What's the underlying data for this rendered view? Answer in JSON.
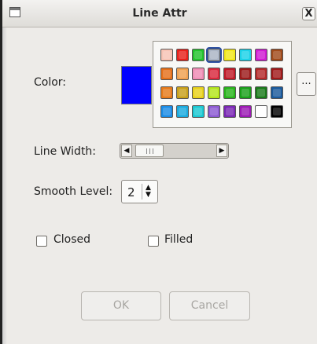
{
  "window": {
    "title": "Line Attr",
    "close_label": "X"
  },
  "color": {
    "label": "Color:",
    "current": "#0000ff",
    "more_button_label": "...",
    "palette": [
      [
        "#f7c3b4",
        "#e8201a",
        "#23c42c",
        "#aab4c4",
        "#f2e81a",
        "#1ad2e8",
        "#d01ad2",
        "#a04a1a"
      ],
      [
        "#e6701a",
        "#f0a050",
        "#f08cb4",
        "#d8283c",
        "#c01a28",
        "#9c1a1a",
        "#b42a2a",
        "#a01a1a"
      ],
      [
        "#e67a1a",
        "#c8a01a",
        "#e8d21a",
        "#b4e61a",
        "#28b41a",
        "#1aa01a",
        "#1a7a1a",
        "#1a5a9c"
      ],
      [
        "#1a8ce6",
        "#1aaade",
        "#1ac8d2",
        "#8c5ad2",
        "#7a28b4",
        "#9c1ab4",
        "#ffffff",
        "#000000"
      ]
    ],
    "selected": [
      0,
      3
    ]
  },
  "line_width": {
    "label": "Line Width:",
    "left_arrow": "◀",
    "right_arrow": "▶"
  },
  "smooth_level": {
    "label": "Smooth Level:",
    "value": "2",
    "arrows": "▲\n▼"
  },
  "options": [
    {
      "label": "Closed",
      "checked": false
    },
    {
      "label": "Filled",
      "checked": false
    }
  ],
  "buttons": {
    "ok": "OK",
    "cancel": "Cancel"
  }
}
